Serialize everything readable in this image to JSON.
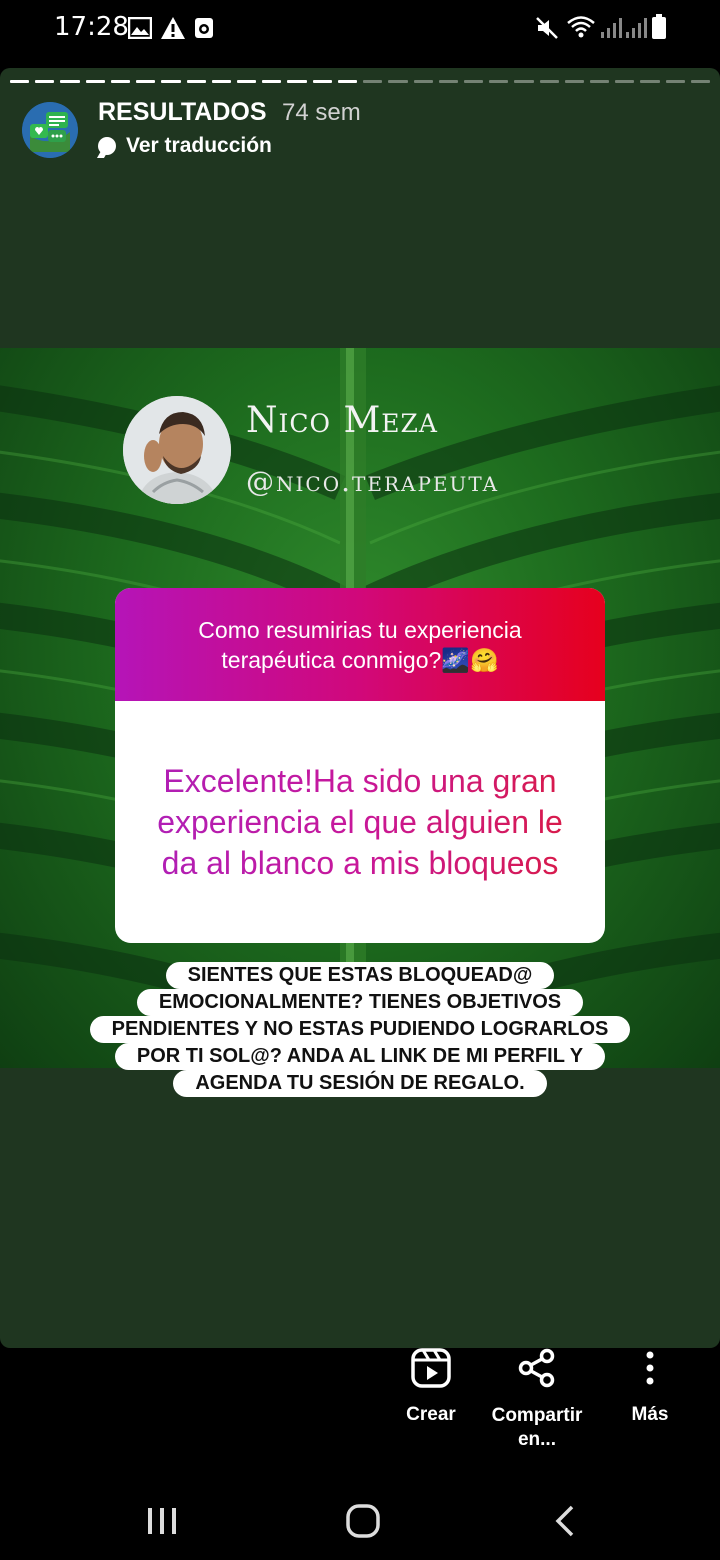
{
  "status_bar": {
    "time": "17:28",
    "left_icons": [
      "image-icon",
      "warning-icon",
      "dnd-app-icon"
    ],
    "right_icons": [
      "mute-icon",
      "wifi-icon",
      "signal-icon",
      "signal-icon",
      "battery-icon"
    ]
  },
  "story": {
    "progress": {
      "total_segments": 28,
      "completed_segments": 14
    },
    "header": {
      "account_name": "RESULTADOS",
      "time_ago": "74 sem",
      "translate_label": "Ver traducción"
    },
    "post": {
      "profile_name": "Nico Meza",
      "profile_handle": "@nico.terapeuta",
      "question": "Como resumirias tu experiencia terapéutica conmigo?🌌🤗",
      "answer": "Excelente!Ha sido una gran experiencia el que alguien le da al blanco a mis bloqueos",
      "caption_lines": [
        "SIENTES QUE ESTAS BLOQUEAD@",
        "EMOCIONALMENTE? TIENES OBJETIVOS",
        "PENDIENTES Y NO ESTAS PUDIENDO LOGRARLOS",
        "POR TI SOL@? ANDA AL LINK DE MI PERFIL Y",
        "AGENDA TU SESIÓN DE REGALO."
      ]
    }
  },
  "actions": {
    "create_label": "Crear",
    "share_label_line1": "Compartir",
    "share_label_line2": "en...",
    "more_label": "Más"
  },
  "colors": {
    "story_bg": "#1f3620",
    "question_gradient": [
      "#b514b8",
      "#e6001d"
    ],
    "answer_gradient": [
      "#b01fb5",
      "#d81a4a"
    ]
  }
}
